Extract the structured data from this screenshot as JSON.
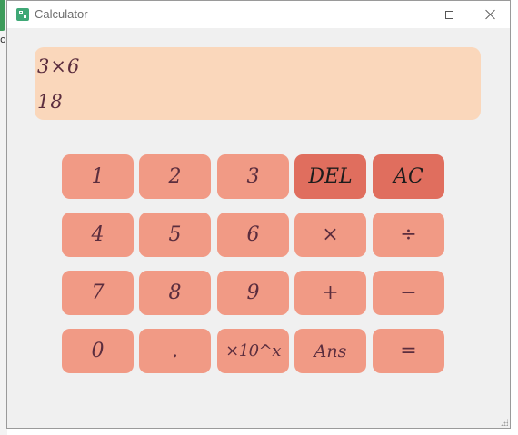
{
  "desktop": {
    "partial_label": "or"
  },
  "window": {
    "title": "Calculator",
    "icon": "calculator-icon",
    "controls": [
      "minimize-icon",
      "maximize-icon",
      "close-icon"
    ]
  },
  "display": {
    "expression": "3×6",
    "result": "18"
  },
  "keys": {
    "k1": "1",
    "k2": "2",
    "k3": "3",
    "del": "DEL",
    "ac": "AC",
    "k4": "4",
    "k5": "5",
    "k6": "6",
    "multiply": "×",
    "divide": "÷",
    "k7": "7",
    "k8": "8",
    "k9": "9",
    "plus": "+",
    "minus": "−",
    "k0": "0",
    "dot": ".",
    "exp": "×10^x",
    "ans": "Ans",
    "equals": "="
  },
  "colors": {
    "display_bg": "#fad7bb",
    "key_bg": "#f19a85",
    "key_dark_bg": "#e06e5e",
    "text": "#5b2d3e"
  }
}
